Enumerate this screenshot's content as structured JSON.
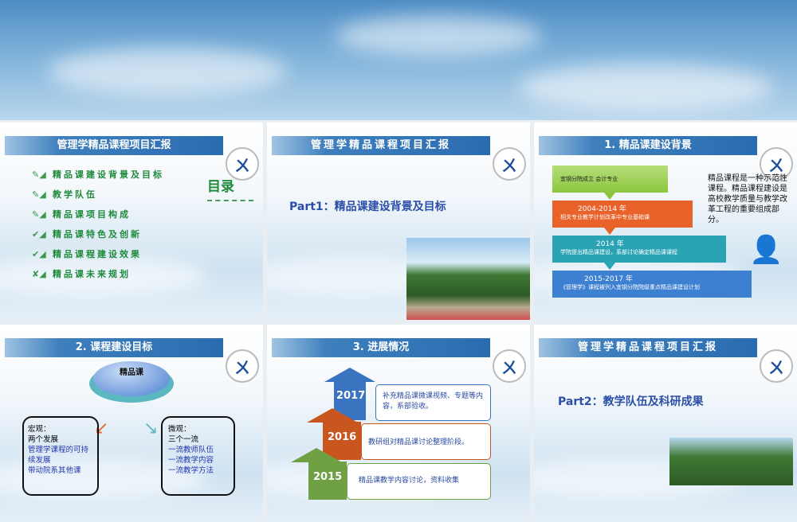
{
  "slides": [
    {
      "title": "管理学精品课程项目汇报",
      "toc_heading": "目录",
      "toc": [
        "精品课建设背景及目标",
        "教学队伍",
        "精品课项目构成",
        "精品课特色及创新",
        "精品课程建设效果",
        "精品课未来规划"
      ]
    },
    {
      "title": "管理学精品课程项目汇报",
      "part": "Part1：精品课建设背景及目标"
    },
    {
      "title": "1. 精品课建设背景",
      "steps": [
        {
          "year": "",
          "text": "宜钢分院成立  会计专业",
          "color": "#8cc63f"
        },
        {
          "year": "2004-2014 年",
          "text": "相关专业教学计划改革中专业基础课",
          "color": "#e8622a"
        },
        {
          "year": "2014 年",
          "text": "学院提出精品课建设，系部讨论确定精品课课程",
          "color": "#2aa3b5"
        },
        {
          "year": "2015-2017 年",
          "text": "《管理学》课程被列入宜钢分院院级重点精品课建设计划",
          "color": "#3d7fd0"
        }
      ],
      "note": "精品课程是一种示范性课程。精品课程建设是高校教学质量与教学改革工程的重要组成部分。"
    },
    {
      "title": "2. 课程建设目标",
      "center": "精品课",
      "macro": {
        "head": "宏观：",
        "sub": "两个发展",
        "items": [
          "管理学课程的可持续发展",
          "带动院系其他课"
        ]
      },
      "micro": {
        "head": "微观：",
        "sub": "三个一流",
        "items": [
          "一流教师队伍",
          "一流教学内容",
          "一流教学方法"
        ]
      }
    },
    {
      "title": "3. 进展情况",
      "stages": [
        {
          "year": "2017",
          "text": "补充精品课微课视频、专题等内容，系部验收。",
          "color": "#3a73c0"
        },
        {
          "year": "2016",
          "text": "教研组对精品课讨论整理阶段。",
          "color": "#c9551f"
        },
        {
          "year": "2015",
          "text": "精品课教学内容讨论，资料收集",
          "color": "#6fa043"
        }
      ]
    },
    {
      "title": "管理学精品课程项目汇报",
      "part": "Part2：教学队伍及科研成果"
    }
  ]
}
